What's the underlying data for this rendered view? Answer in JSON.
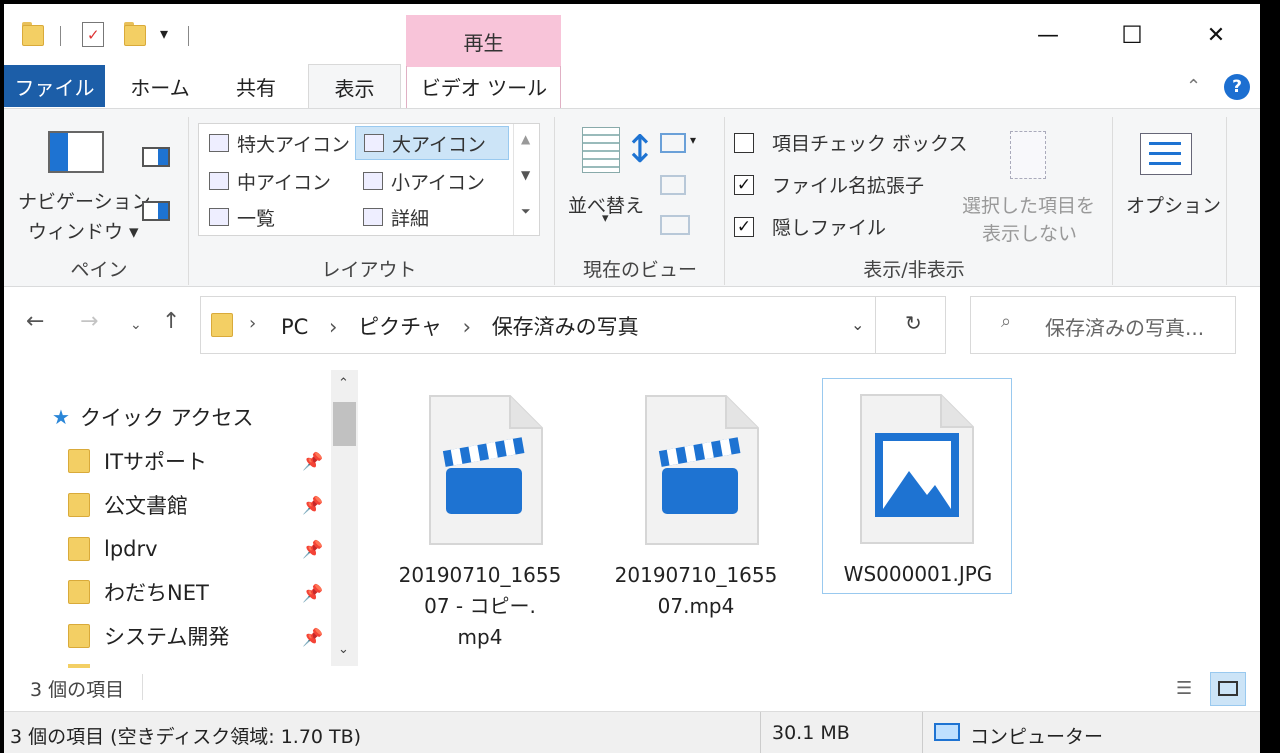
{
  "quick_access": {
    "dropdown_glyph": "▾"
  },
  "window_controls": {
    "minimize": "—",
    "maximize": "☐",
    "close": "✕"
  },
  "tabs": {
    "file": "ファイル",
    "home": "ホーム",
    "share": "共有",
    "view": "表示",
    "context_header": "再生",
    "video_tools": "ビデオ ツール"
  },
  "ribbon": {
    "pane": {
      "nav_pane_line1": "ナビゲーション",
      "nav_pane_line2": "ウィンドウ ▾",
      "label": "ペイン"
    },
    "layout": {
      "items": [
        "特大アイコン",
        "大アイコン",
        "中アイコン",
        "小アイコン",
        "一覧",
        "詳細"
      ],
      "selected": "大アイコン",
      "label": "レイアウト"
    },
    "current_view": {
      "sort_line1": "並べ替え",
      "sort_line2": "▾",
      "label": "現在のビュー"
    },
    "show_hide": {
      "item_checkbox": {
        "label": "項目チェック ボックス",
        "checked": false
      },
      "file_ext": {
        "label": "ファイル名拡張子",
        "checked": true
      },
      "hidden_files": {
        "label": "隠しファイル",
        "checked": true
      },
      "hide_selected_line1": "選択した項目を",
      "hide_selected_line2": "表示しない",
      "label": "表示/非表示"
    },
    "options": "オプション"
  },
  "address": {
    "crumbs": [
      "PC",
      "ピクチャ",
      "保存済みの写真"
    ],
    "separator": "›",
    "search_placeholder": "保存済みの写真..."
  },
  "nav_pane": {
    "quick_access": "クイック アクセス",
    "items": [
      "ITサポート",
      "公文書館",
      "lpdrv",
      "わだちNET",
      "システム開発"
    ]
  },
  "files": [
    {
      "name_line1": "20190710_1655",
      "name_line2": "07 - コピー.",
      "name_line3": "mp4",
      "type": "video"
    },
    {
      "name_line1": "20190710_1655",
      "name_line2": "07.mp4",
      "type": "video"
    },
    {
      "name_line1": "WS000001.JPG",
      "type": "image",
      "selected": true
    }
  ],
  "status": {
    "item_count": "3 個の項目",
    "bottom_left": "3 個の項目 (空きディスク領域: 1.70 TB)",
    "size": "30.1 MB",
    "location": "コンピューター"
  },
  "colors": {
    "accent": "#1c5ea8",
    "icon_blue": "#1e73d2",
    "context_tab": "#f8c4d9"
  }
}
